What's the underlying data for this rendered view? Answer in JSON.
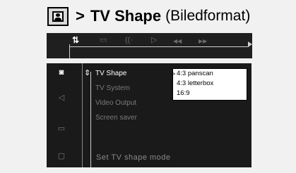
{
  "heading": {
    "icon": "person-photo-icon",
    "arrow": ">",
    "title": "TV Shape",
    "subtitle": "(Biledformat)"
  },
  "toolbar": {
    "icons": [
      {
        "name": "settings-tools-icon",
        "glyph": "⇅",
        "active": true
      },
      {
        "name": "subtitle-icon",
        "glyph": "▭",
        "active": false
      },
      {
        "name": "audio-icon",
        "glyph": "((·",
        "active": false
      },
      {
        "name": "play-icon",
        "glyph": "▷",
        "active": false
      },
      {
        "name": "rewind-icon",
        "glyph": "◀◀",
        "active": false
      },
      {
        "name": "fast-forward-icon",
        "glyph": "▶▶",
        "active": false
      }
    ]
  },
  "sidebar": {
    "icons": [
      {
        "name": "picture-icon",
        "glyph": "◙",
        "active": true
      },
      {
        "name": "speaker-icon",
        "glyph": "◁",
        "active": false
      },
      {
        "name": "subtitle-language-icon",
        "glyph": "▭",
        "active": false
      },
      {
        "name": "lock-icon",
        "glyph": "▢",
        "active": false
      }
    ]
  },
  "menu": {
    "items": [
      {
        "label": "TV Shape",
        "active": true
      },
      {
        "label": "TV System",
        "active": false
      },
      {
        "label": "Video Output",
        "active": false
      },
      {
        "label": "Screen saver",
        "active": false
      }
    ]
  },
  "dropdown": {
    "options": [
      "4:3 panscan",
      "4:3 letterbox",
      "16:9"
    ],
    "selected_index": 0,
    "marker": ">"
  },
  "status": "Set TV shape mode",
  "colors": {
    "panel_bg": "#1a1a1a",
    "page_bg": "#f1f1f1",
    "dropdown_bg": "#ffffff",
    "inactive_text": "#7a7a7a",
    "active_text": "#ffffff"
  }
}
